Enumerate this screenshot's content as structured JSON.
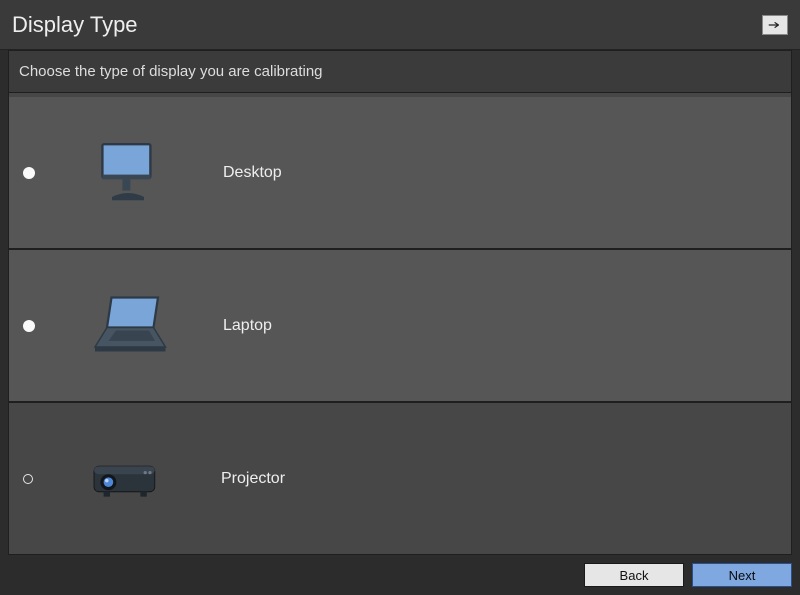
{
  "header": {
    "title": "Display Type"
  },
  "instruction": "Choose the type of display you are calibrating",
  "options": [
    {
      "id": "desktop",
      "label": "Desktop",
      "icon": "desktop-monitor-icon",
      "selected": false,
      "styleFilled": true
    },
    {
      "id": "laptop",
      "label": "Laptop",
      "icon": "laptop-icon",
      "selected": false,
      "styleFilled": true
    },
    {
      "id": "projector",
      "label": "Projector",
      "icon": "projector-icon",
      "selected": false,
      "styleFilled": false
    }
  ],
  "buttons": {
    "back": "Back",
    "next": "Next"
  },
  "colors": {
    "accent": "#7fa8e0",
    "panel": "#474747",
    "option": "#565656",
    "bg": "#2c2c2c"
  }
}
